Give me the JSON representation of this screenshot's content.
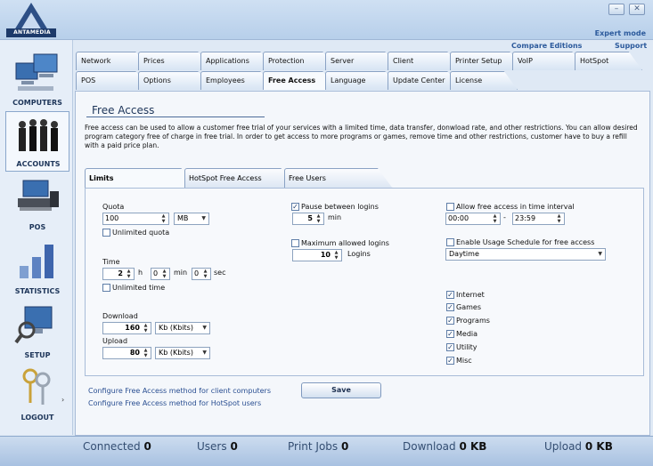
{
  "header": {
    "logo_text": "ANTAMEDIA",
    "expert_mode": "Expert mode",
    "compare_editions": "Compare Editions",
    "support": "Support",
    "minimize": "–",
    "close": "✕"
  },
  "nav": {
    "computers": "COMPUTERS",
    "accounts": "ACCOUNTS",
    "pos": "POS",
    "statistics": "STATISTICS",
    "setup": "SETUP",
    "logout": "LOGOUT",
    "more_arrow": "›"
  },
  "tabs_row1": [
    "Network",
    "Prices",
    "Applications",
    "Protection",
    "Server",
    "Client",
    "Printer Setup",
    "VoIP",
    "HotSpot"
  ],
  "tabs_row2": [
    "POS",
    "Options",
    "Employees",
    "Free Access",
    "Language",
    "Update Center",
    "License"
  ],
  "active_tab": "Free Access",
  "page": {
    "title": "Free Access",
    "description": "Free access can be used to allow a customer free trial of your services with a limited time, data transfer, donwload rate, and other restrictions. You can allow desired program category free of charge in free trial. In order to get access to more programs or games, remove time and other restrictions, customer have to buy a refill with a paid price plan."
  },
  "subtabs": [
    "Limits",
    "HotSpot Free Access",
    "Free Users"
  ],
  "limits": {
    "quota_label": "Quota",
    "quota_value": "100",
    "quota_unit": "MB",
    "unlimited_quota": "Unlimited quota",
    "time_label": "Time",
    "time_h": "2",
    "h_label": "h",
    "time_min": "0",
    "min_label": "min",
    "time_sec": "0",
    "sec_label": "sec",
    "unlimited_time": "Unlimited time",
    "download_label": "Download",
    "download_value": "160",
    "download_unit": "Kb (Kbits)",
    "upload_label": "Upload",
    "upload_value": "80",
    "upload_unit": "Kb (Kbits)",
    "pause_label": "Pause between logins",
    "pause_value": "5",
    "pause_unit": "min",
    "max_logins_label": "Maximum allowed logins",
    "max_logins_value": "10",
    "logins_unit": "Logins",
    "allow_interval_label": "Allow free access in time interval",
    "interval_from": "00:00",
    "interval_sep": "-",
    "interval_to": "23:59",
    "usage_schedule_label": "Enable Usage Schedule for free access",
    "schedule_value": "Daytime",
    "categories": [
      "Internet",
      "Games",
      "Programs",
      "Media",
      "Utility",
      "Misc"
    ]
  },
  "links": {
    "client_method": "Configure Free Access method for client computers",
    "hotspot_method": "Configure Free Access method for HotSpot users"
  },
  "save_label": "Save",
  "status": {
    "connected_label": "Connected",
    "connected_value": "0",
    "users_label": "Users",
    "users_value": "0",
    "print_label": "Print Jobs",
    "print_value": "0",
    "download_label": "Download",
    "download_value": "0 KB",
    "upload_label": "Upload",
    "upload_value": "0 KB"
  }
}
